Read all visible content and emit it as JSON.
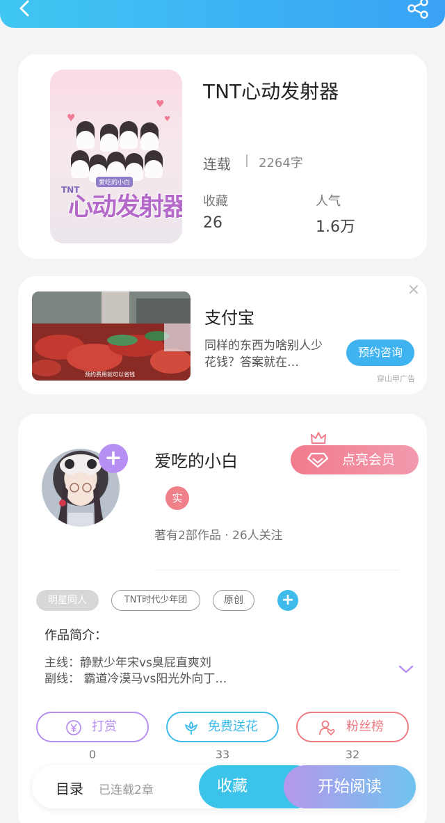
{
  "book": {
    "title": "TNT心动发射器",
    "status": "连载",
    "word_count": "2264字",
    "favorites_label": "收藏",
    "favorites_value": "26",
    "popularity_label": "人气",
    "popularity_value": "1.6万",
    "cover_title_text": "心动发射器",
    "cover_tnt": "TNT",
    "cover_tag": "爱吃的小白"
  },
  "ad": {
    "title": "支付宝",
    "description": "同样的东西为啥别人少花钱？答案就在…",
    "button": "预约咨询",
    "source": "穿山甲广告",
    "close": "×",
    "image_caption": "预约费用就可以省钱"
  },
  "author": {
    "name": "爱吃的小白",
    "real_badge": "实",
    "meta": "著有2部作品 · 26人关注",
    "vip_button": "点亮会员"
  },
  "tags": [
    "明星同人",
    "TNT时代少年团",
    "原创"
  ],
  "intro": {
    "label": "作品简介：",
    "line1": "主线：静默少年宋vs臭屁直爽刘",
    "line2": "副线：  霸道冷漠马vs阳光外向丁…"
  },
  "actions": [
    {
      "label": "打赏",
      "count": "0",
      "icon": "yen-coin-icon",
      "color": "#b78ef2"
    },
    {
      "label": "免费送花",
      "count": "33",
      "icon": "flower-icon",
      "color": "#3fbbe9"
    },
    {
      "label": "粉丝榜",
      "count": "32",
      "icon": "user-heart-icon",
      "color": "#f07b84"
    }
  ],
  "bottom": {
    "toc": "目录",
    "toc_sub": "已连载2章",
    "collect": "收藏",
    "read": "开始阅读"
  },
  "colors": {
    "accent_blue": "#3fc6f2",
    "accent_purple": "#b78ef2",
    "accent_pink": "#f17b8c"
  }
}
